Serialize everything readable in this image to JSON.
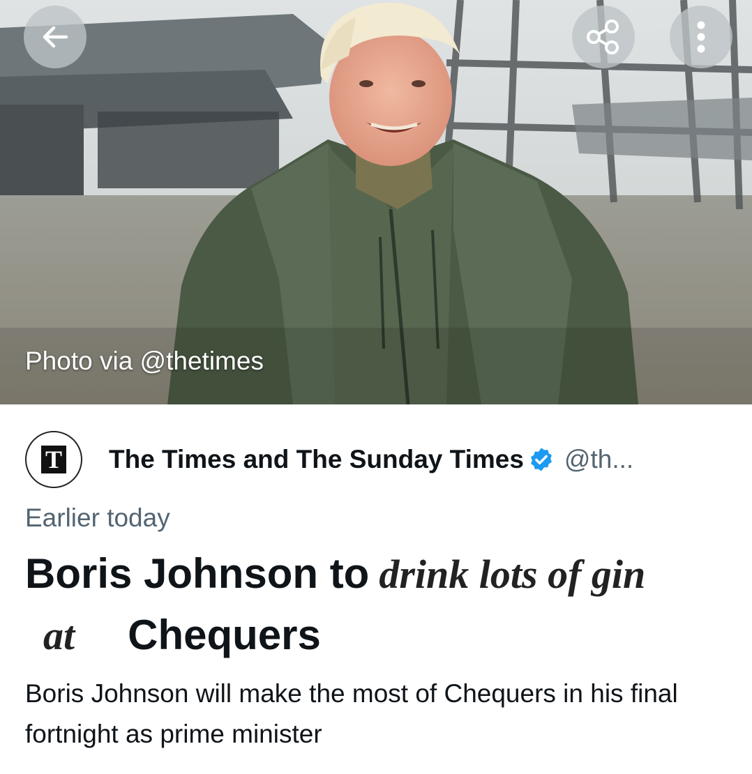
{
  "photo": {
    "caption": "Photo via @thetimes"
  },
  "toolbar": {
    "back_icon": "arrow-left-icon",
    "share_icon": "share-icon",
    "more_icon": "more-vertical-icon"
  },
  "source": {
    "logo_letter": "T",
    "name": "The Times and The Sunday Times",
    "handle": "@th...",
    "verified_color": "#1d9bf0"
  },
  "article": {
    "time": "Earlier today",
    "headline": {
      "line1_sans": "Boris Johnson to",
      "line1_serif": "drink lots of gin",
      "line2_serif": "at",
      "line2_sans": "Chequers"
    },
    "summary": "Boris Johnson will make the most of Chequers in his final fortnight as prime minister"
  }
}
